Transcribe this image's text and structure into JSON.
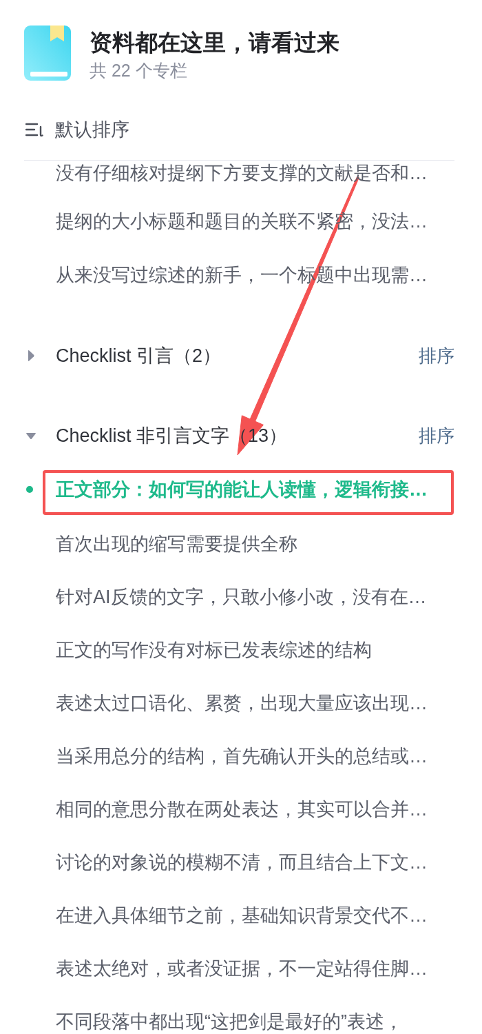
{
  "header": {
    "title": "资料都在这里，请看过来",
    "subtitle": "共 22 个专栏"
  },
  "sort": {
    "label": "默认排序"
  },
  "sections": [
    {
      "items": [
        {
          "text": "没有仔细核对提纲下方要支撑的文献是否和…",
          "selected": false,
          "highlighted": false
        },
        {
          "text": "提纲的大小标题和题目的关联不紧密，没法…",
          "selected": false,
          "highlighted": false
        },
        {
          "text": "从来没写过综述的新手，一个标题中出现需…",
          "selected": false,
          "highlighted": false
        }
      ]
    },
    {
      "title": "Checklist 引言（2）",
      "expanded": false,
      "sort_label": "排序"
    },
    {
      "title": "Checklist 非引言文字（13）",
      "expanded": true,
      "sort_label": "排序",
      "items": [
        {
          "text": "正文部分：如何写的能让人读懂，逻辑衔接…",
          "selected": true,
          "highlighted": true
        },
        {
          "text": "首次出现的缩写需要提供全称",
          "selected": false,
          "highlighted": false
        },
        {
          "text": "针对AI反馈的文字，只敢小修小改，没有在…",
          "selected": false,
          "highlighted": false
        },
        {
          "text": "正文的写作没有对标已发表综述的结构",
          "selected": false,
          "highlighted": false
        },
        {
          "text": "表述太过口语化、累赘，出现大量应该出现…",
          "selected": false,
          "highlighted": false
        },
        {
          "text": "当采用总分的结构，首先确认开头的总结或…",
          "selected": false,
          "highlighted": false
        },
        {
          "text": "相同的意思分散在两处表达，其实可以合并…",
          "selected": false,
          "highlighted": false
        },
        {
          "text": "讨论的对象说的模糊不清，而且结合上下文…",
          "selected": false,
          "highlighted": false
        },
        {
          "text": "在进入具体细节之前，基础知识背景交代不…",
          "selected": false,
          "highlighted": false
        },
        {
          "text": "表述太绝对，或者没证据，不一定站得住脚…",
          "selected": false,
          "highlighted": false
        },
        {
          "text": "不同段落中都出现“这把剑是最好的”表述，",
          "selected": false,
          "highlighted": false
        }
      ]
    }
  ],
  "annotations": [
    {
      "kind": "arrow"
    }
  ]
}
